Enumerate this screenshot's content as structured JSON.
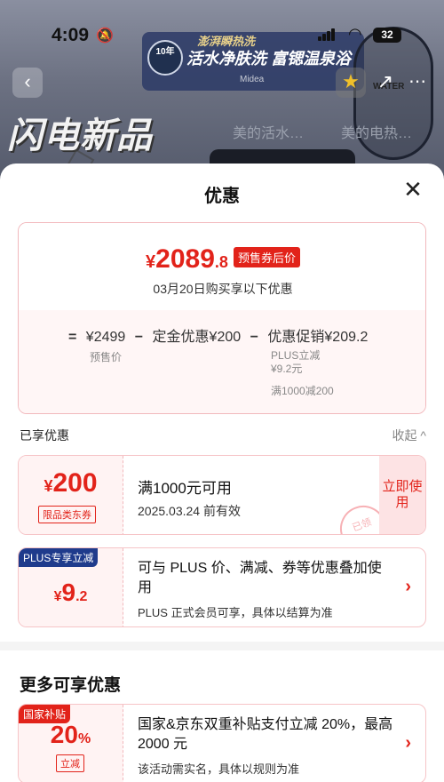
{
  "status_bar": {
    "time": "4:09",
    "battery": "32"
  },
  "background": {
    "banner_top": "澎湃瞬热洗",
    "banner_main": "活水净肤洗 富锶温泉浴",
    "banner_badge": "10年",
    "brand_small": "Midea",
    "flash_title": "闪电新品",
    "tab1": "美的活水…",
    "tab2": "美的电热…",
    "round_label": "WATER"
  },
  "sheet": {
    "title": "优惠",
    "price_card": {
      "currency": "¥",
      "price_int": "2089",
      "price_dec": ".8",
      "tag": "预售券后价",
      "subtitle": "03月20日购买享以下优惠",
      "formula": {
        "eq": "=",
        "base": "¥2499",
        "minus1": "−",
        "deposit": "定金优惠¥200",
        "minus2": "−",
        "promo": "优惠促销¥209.2"
      },
      "base_label": "预售价",
      "promo_detail_1": "PLUS立减",
      "promo_detail_2": "¥9.2元",
      "promo_detail_3": "满1000减200"
    },
    "enjoyed": {
      "title": "已享优惠",
      "collapse": "收起 ^"
    },
    "coupons": [
      {
        "currency": "¥",
        "amount": "200",
        "tag": "限品类东券",
        "title": "满1000元可用",
        "date": "2025.03.24 前有效",
        "action": "立即使用",
        "stamp": "已领"
      },
      {
        "badge": "PLUS专享立减",
        "currency": "¥",
        "amount": "9",
        "dec": ".2",
        "title": "可与 PLUS 价、满减、券等优惠叠加使用",
        "desc": "PLUS 正式会员可享，具体以结算为准"
      }
    ],
    "more": {
      "title": "更多可享优惠",
      "coupon": {
        "badge": "国家补贴",
        "amount": "20",
        "pct": "%",
        "tag": "立减",
        "title": "国家&京东双重补贴支付立减 20%，最高 2000 元",
        "desc": "该活动需实名，具体以规则为准"
      }
    }
  },
  "colors": {
    "accent": "#e2231a",
    "plus": "#1f3b8c"
  }
}
